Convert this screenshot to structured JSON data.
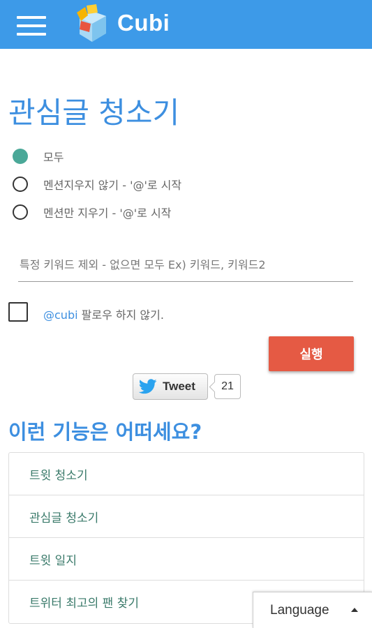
{
  "header": {
    "brand": "Cubi",
    "menu_icon": "hamburger-menu-icon",
    "logo_icon": "cube-logo-icon",
    "color": "#3d9ae8"
  },
  "page": {
    "title": "관심글 청소기"
  },
  "options": [
    {
      "label": "모두",
      "checked": true
    },
    {
      "label": "멘션지우지 않기 - '@'로 시작",
      "checked": false
    },
    {
      "label": "멘션만 지우기 - '@'로 시작",
      "checked": false
    }
  ],
  "keyword_input": {
    "value": "",
    "placeholder": "특정 키워드 제외 - 없으면 모두 Ex) 키워드, 키워드2"
  },
  "follow_checkbox": {
    "checked": false,
    "handle": "@cubi",
    "label_rest": " 팔로우 하지 않기."
  },
  "run_button": {
    "label": "실행",
    "color": "#e55a44"
  },
  "tweet": {
    "label": "Tweet",
    "count": "21",
    "icon": "twitter-bird-icon"
  },
  "suggestions": {
    "title": "이런 기능은 어떠세요?",
    "items": [
      "트윗 청소기",
      "관심글 청소기",
      "트윗 일지",
      "트위터 최고의 팬 찾기"
    ]
  },
  "language": {
    "label": "Language",
    "icon": "caret-up-icon"
  },
  "colors": {
    "accent_blue": "#3d8fe0",
    "radio_checked": "#4aa898"
  }
}
